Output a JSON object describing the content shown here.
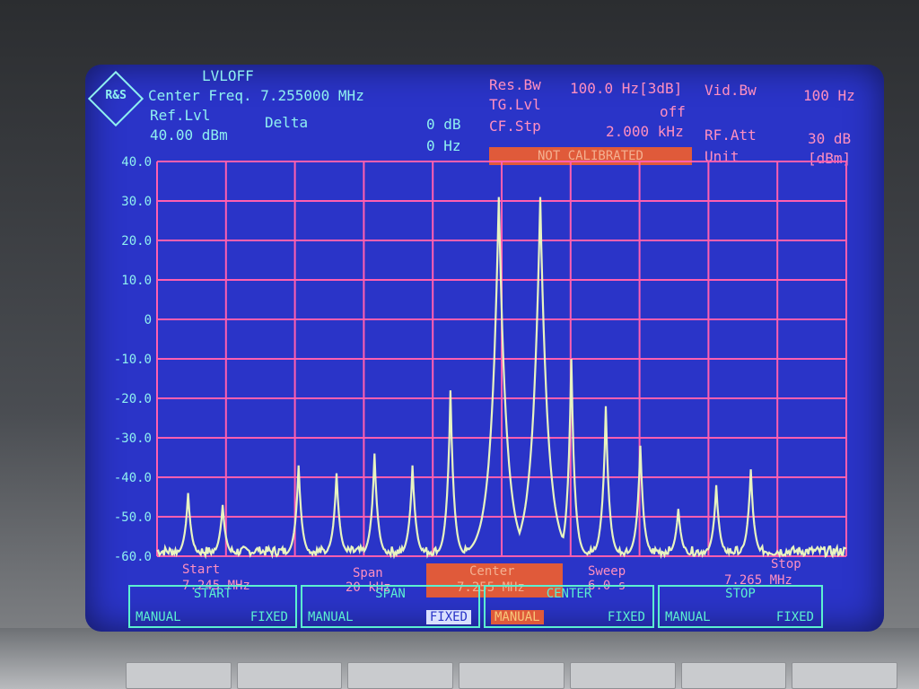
{
  "header": {
    "lvloff": "LVLOFF",
    "center_freq": "Center Freq. 7.255000 MHz",
    "ref_lvl_label": "Ref.Lvl",
    "ref_lvl_value": "40.00 dBm",
    "delta_label": "Delta",
    "delta_db": "0 dB",
    "delta_hz": "0 Hz",
    "res_bw_label": "Res.Bw",
    "res_bw_value": "100.0 Hz[3dB]",
    "vid_bw_label": "Vid.Bw",
    "vid_bw_value": "100 Hz",
    "tg_lvl_label": "TG.Lvl",
    "tg_lvl_value": "off",
    "cf_stp_label": "CF.Stp",
    "cf_stp_value": "2.000 kHz",
    "rf_att_label": "RF.Att",
    "rf_att_value": "30 dB",
    "unit_label": "Unit",
    "unit_value": "[dBm]",
    "not_calibrated": "NOT CALIBRATED",
    "logo": "R&S"
  },
  "footer": {
    "start_label": "Start",
    "start_value": "7.245 MHz",
    "span_label": "Span",
    "span_value": "20 kHz",
    "center_label": "Center",
    "center_value": "7.255 MHz",
    "sweep_label": "Sweep",
    "sweep_value": "6.0 s",
    "stop_label": "Stop",
    "stop_value": "7.265 MHz"
  },
  "softkeys": [
    {
      "title": "START",
      "left": "MANUAL",
      "right": "FIXED"
    },
    {
      "title": "SPAN",
      "left": "MANUAL",
      "right": "FIXED"
    },
    {
      "title": "CENTER",
      "left": "MANUAL",
      "right": "FIXED"
    },
    {
      "title": "STOP",
      "left": "MANUAL",
      "right": "FIXED"
    }
  ],
  "colors": {
    "screen": "#2a34c8",
    "grid": "#ff5fb0",
    "trace": "#e8f4c0",
    "text_cyan": "#8ff0f0",
    "text_pink": "#ff8fc0",
    "highlight": "#e05a3a"
  },
  "chart_data": {
    "type": "line",
    "yticks": [
      "40.0",
      "30.0",
      "20.0",
      "10.0",
      "0",
      "-10.0",
      "-20.0",
      "-30.0",
      "-40.0",
      "-50.0",
      "-60.0"
    ],
    "ylim": [
      -60,
      40
    ],
    "xlim": [
      7.245,
      7.265
    ],
    "x_unit": "MHz",
    "y_unit": "dBm",
    "noise_floor": -60,
    "peaks": [
      {
        "x": 7.2459,
        "y": -44
      },
      {
        "x": 7.2469,
        "y": -47
      },
      {
        "x": 7.2479,
        "y": -58
      },
      {
        "x": 7.2491,
        "y": -37
      },
      {
        "x": 7.2502,
        "y": -39
      },
      {
        "x": 7.2513,
        "y": -34
      },
      {
        "x": 7.2524,
        "y": -37
      },
      {
        "x": 7.2535,
        "y": -18
      },
      {
        "x": 7.2549,
        "y": 31
      },
      {
        "x": 7.2561,
        "y": 31
      },
      {
        "x": 7.257,
        "y": -10
      },
      {
        "x": 7.258,
        "y": -22
      },
      {
        "x": 7.259,
        "y": -32
      },
      {
        "x": 7.2601,
        "y": -48
      },
      {
        "x": 7.2612,
        "y": -42
      },
      {
        "x": 7.2622,
        "y": -38
      }
    ],
    "valley_between_main": -45
  }
}
